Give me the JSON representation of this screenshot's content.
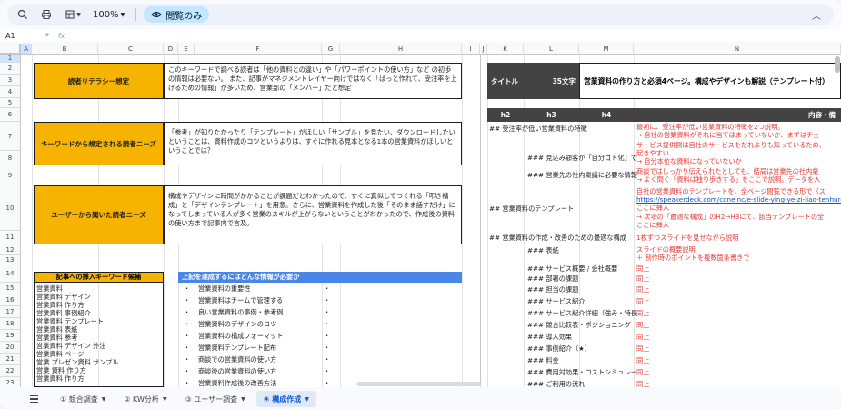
{
  "toolbar": {
    "zoom": "100%",
    "view_mode": "閲覧のみ"
  },
  "formula_bar": {
    "cell_ref": "A1",
    "fx": "fx"
  },
  "columns": [
    "A",
    "B",
    "C",
    "D",
    "E",
    "F",
    "G",
    "H",
    "I",
    "J",
    "K",
    "L",
    "M",
    "N"
  ],
  "rows": [
    "1",
    "2",
    "3",
    "4",
    "5",
    "6",
    "7",
    "8",
    "9",
    "10",
    "11",
    "12",
    "13",
    "14",
    "15",
    "16",
    "17",
    "18",
    "19",
    "20",
    "21",
    "22",
    "23"
  ],
  "left": {
    "block1": {
      "label": "読者リテラシー想定",
      "text": "このキーワードで調べる読者は「他の資料との違い」や「パワーポイントの使い方」など の初歩の情報は必要ない。 また、記事がマネジメントレイヤー向けではなく「ぱっと作れて、受注率を上げるための情報」が多いため、営業部の「メンバー」だと想定"
    },
    "block2": {
      "label": "キーワードから想定される読者ニーズ",
      "text": "「参考」が知りたかったり「テンプレート」がほしい「サンプル」を見たい、ダウンロードしたいということは、資料作成のコツというよりは、すぐに作れる見本となる1本の営業資料がほしいということでは？"
    },
    "block3": {
      "label": "ユーザーから聞いた読者ニーズ",
      "text": "構成やデザインに時間がかかることが課題だとわかったので、すぐに真似してつくれる「叩き構成」と「デザインテンプレート」を用意。さらに、営業資料を作成した後「そのまま話すだけ」になってしまっている人が多く営業のスキルが上がらないということがわかったので、作成後の資料の使い方まで記事内で言及。"
    },
    "kw_header": "記事への挿入キーワード候補",
    "keywords": [
      "営業資料",
      "営業資料 デザイン",
      "営業資料 作り方",
      "営業資料 事例紹介",
      "営業資料 テンプレート",
      "営業資料 表紙",
      "営業資料 参考",
      "営業資料 デザイン 外注",
      "営業資料 ページ",
      "営業 プレゼン資料 サンプル",
      "営業 資料 作り方",
      "営業資料 作り方"
    ],
    "info_header": "上記を達成するにはどんな情報が必要か",
    "info_items": [
      "営業資料の重要性",
      "営業資料はチームで管理する",
      "良い営業資料の事例・参考例",
      "営業資料のデザインのコツ",
      "営業資料の構成フォーマット",
      "営業資料テンプレート配布",
      "商談での営業資料の使い方",
      "商談後の営業資料の使い方",
      "営業資料作成後の改善方法"
    ],
    "bullet": "・"
  },
  "right": {
    "title_label": "タイトル",
    "char_count": "35文字",
    "title_text": "営業資料の作り方と必須4ページ。構成やデザインも解説（テンプレート付）",
    "headers": {
      "h2": "h2",
      "h3": "h3",
      "h4": "h4",
      "content": "内容・備"
    },
    "outline": [
      {
        "level": "h2",
        "text": "## 受注率が低い営業資料の特徴"
      },
      {
        "level": "h3",
        "text": "### 見込み顧客が「自分ゴト化」で"
      },
      {
        "level": "h3",
        "text": "### 営業先の社内稟議に必要な情報"
      },
      {
        "level": "h2",
        "text": "## 営業資料のテンプレート"
      },
      {
        "level": "h2",
        "text": "## 営業資料の作成・改善のための最適な構成"
      },
      {
        "level": "h3",
        "text": "### 表紙"
      },
      {
        "level": "h3",
        "text": "### サービス概要 / 会社概要"
      },
      {
        "level": "h3",
        "text": "### 部署の課題"
      },
      {
        "level": "h3",
        "text": "### 担当の課題"
      },
      {
        "level": "h3",
        "text": "### サービス紹介"
      },
      {
        "level": "h3",
        "text": "### サービス紹介詳細（強み・特長"
      },
      {
        "level": "h3",
        "text": "### 競合比較表・ポジショニング"
      },
      {
        "level": "h3",
        "text": "### 導入効果"
      },
      {
        "level": "h3",
        "text": "### 事例紹介（★）"
      },
      {
        "level": "h3",
        "text": "### 料金"
      },
      {
        "level": "h3",
        "text": "### 費用対効果・コストシミュレー"
      },
      {
        "level": "h3",
        "text": "### ご利用の流れ"
      }
    ],
    "notes": {
      "n1a": "最初に、受注率が低い営業資料の特徴を2つ説明。",
      "n1b": "→ 自社の営業資料がそれに当てはまっていないか、まずはチェ",
      "n1c": "サービス提供側は自社のサービスをだれよりも知っているため、",
      "n1d": "起きやすい",
      "n1e": "→ 自分本位な資料になっていないか",
      "n2a": "商談ではしっかり伝えられたとしても、結局は営業先の社内稟",
      "n2b": "→ よく間く「資料は独り歩きする」をここで説明。データを入",
      "n3a": "自社の営業資料のテンプレートを、全ページ閲覧できる形で（ス",
      "n3link": "https://speakerdeck.com/coneinc/e-slide-ying-ye-zi-liao-tenhuret",
      "n3b": "ここに挿入",
      "n4a": "→ 次項の「最適な構成」のH2→H3にて、該当テンプレートの全",
      "n4b": "ここに挿入",
      "n5": "1枚ずつスライドを見せながら説明",
      "n6a": "スライドの概要説明",
      "n6b": "＋ 制作時のポイントを複数箇条書きで",
      "same": "同上"
    }
  },
  "sheet_tabs": [
    {
      "label": "① 競合調査",
      "active": false
    },
    {
      "label": "② KW分析",
      "active": false
    },
    {
      "label": "③ ユーザー調査",
      "active": false
    },
    {
      "label": "④ 構成作成",
      "active": true
    }
  ]
}
